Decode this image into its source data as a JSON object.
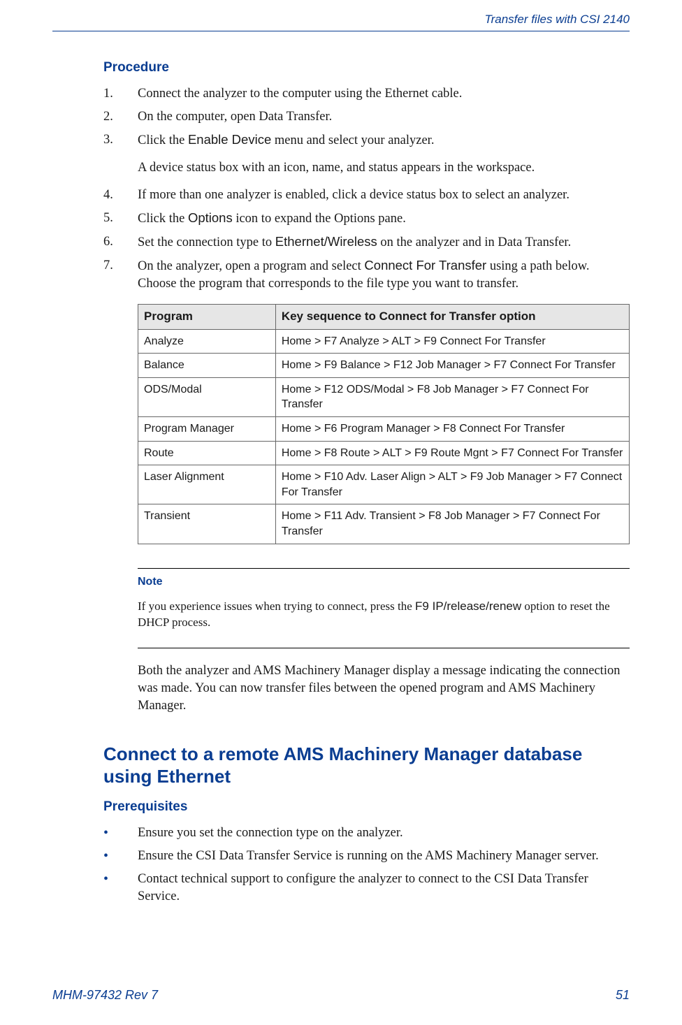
{
  "header": {
    "right": "Transfer files with CSI 2140"
  },
  "main": {
    "procedure_heading": "Procedure",
    "steps": [
      {
        "n": "1.",
        "text_a": "Connect the analyzer to the computer using the Ethernet cable."
      },
      {
        "n": "2.",
        "text_a": "On the computer, open Data Transfer."
      },
      {
        "n": "3.",
        "text_a": "Click the ",
        "ui_a": "Enable Device",
        "text_b": " menu and select your analyzer.",
        "after": "A device status box with an icon, name, and status appears in the workspace."
      },
      {
        "n": "4.",
        "text_a": "If more than one analyzer is enabled, click a device status box to select an analyzer."
      },
      {
        "n": "5.",
        "text_a": "Click the ",
        "ui_a": "Options",
        "text_b": " icon to expand the Options pane."
      },
      {
        "n": "6.",
        "text_a": "Set the connection type to ",
        "ui_a": "Ethernet/Wireless",
        "text_b": " on the analyzer and in Data Transfer."
      },
      {
        "n": "7.",
        "text_a": "On the analyzer, open a program and select ",
        "ui_a": "Connect For Transfer",
        "text_b": " using a path below. Choose the program that corresponds to the file type you want to transfer."
      }
    ],
    "table": {
      "head_a": "Program",
      "head_b": "Key sequence to Connect for Transfer option",
      "rows": [
        {
          "a": "Analyze",
          "b": "Home > F7 Analyze > ALT > F9 Connect For Transfer"
        },
        {
          "a": "Balance",
          "b": "Home > F9 Balance > F12 Job Manager > F7 Connect For Transfer"
        },
        {
          "a": "ODS/Modal",
          "b": "Home > F12 ODS/Modal > F8 Job Manager > F7 Connect For Transfer"
        },
        {
          "a": "Program Manager",
          "b": "Home > F6 Program Manager > F8 Connect For Transfer"
        },
        {
          "a": "Route",
          "b": "Home > F8 Route > ALT > F9 Route Mgnt > F7 Connect For Transfer"
        },
        {
          "a": "Laser Alignment",
          "b": "Home > F10 Adv. Laser Align > ALT > F9 Job Manager > F7 Connect For Transfer"
        },
        {
          "a": "Transient",
          "b": "Home > F11 Adv. Transient > F8 Job Manager > F7 Connect For Transfer"
        }
      ]
    },
    "note": {
      "label": "Note",
      "text_a": "If you experience issues when trying to connect, press the ",
      "ui_a": "F9 IP/release/renew",
      "text_b": " option to reset the DHCP process."
    },
    "post_note": "Both the analyzer and AMS Machinery Manager display a message indicating the connection was made. You can now transfer files between the opened program and AMS Machinery Manager.",
    "section_heading": "Connect to a remote AMS Machinery Manager database using Ethernet",
    "prereq_heading": "Prerequisites",
    "prereq_items": [
      "Ensure you set the connection type on the analyzer.",
      "Ensure the CSI Data Transfer Service is running on the AMS Machinery Manager server.",
      "Contact technical support to configure the analyzer to connect to the CSI Data Transfer Service."
    ]
  },
  "footer": {
    "left": "MHM-97432 Rev 7",
    "right": "51"
  }
}
